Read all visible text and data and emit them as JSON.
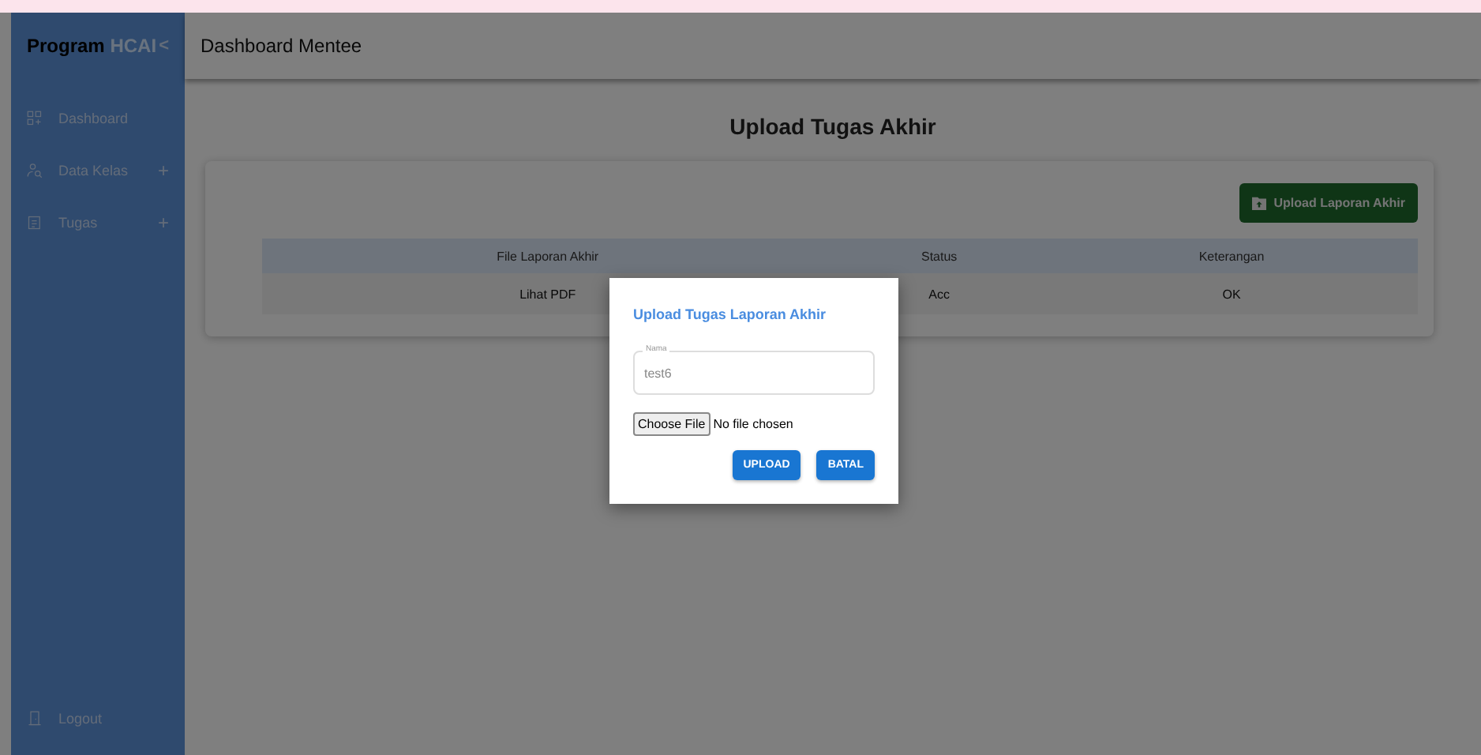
{
  "sidebar": {
    "brand": "Program",
    "brand_accent": "HCAI",
    "collapse": "<",
    "items": [
      {
        "label": "Dashboard"
      },
      {
        "label": "Data Kelas",
        "toggle": "+"
      },
      {
        "label": "Tugas",
        "toggle": "+"
      }
    ],
    "logout": "Logout"
  },
  "header": {
    "title": "Dashboard Mentee"
  },
  "page": {
    "title": "Upload Tugas Akhir",
    "upload_button": "Upload Laporan Akhir",
    "table": {
      "columns": [
        "File Laporan Akhir",
        "Status",
        "Keterangan"
      ],
      "rows": [
        [
          "Lihat PDF",
          "Acc",
          "OK"
        ]
      ]
    }
  },
  "dialog": {
    "title": "Upload Tugas Laporan Akhir",
    "field": {
      "label": "Nama",
      "value": "test6"
    },
    "file": {
      "button": "Choose File",
      "status": "No file chosen"
    },
    "buttons": [
      "UPLOAD",
      "BATAL"
    ]
  }
}
